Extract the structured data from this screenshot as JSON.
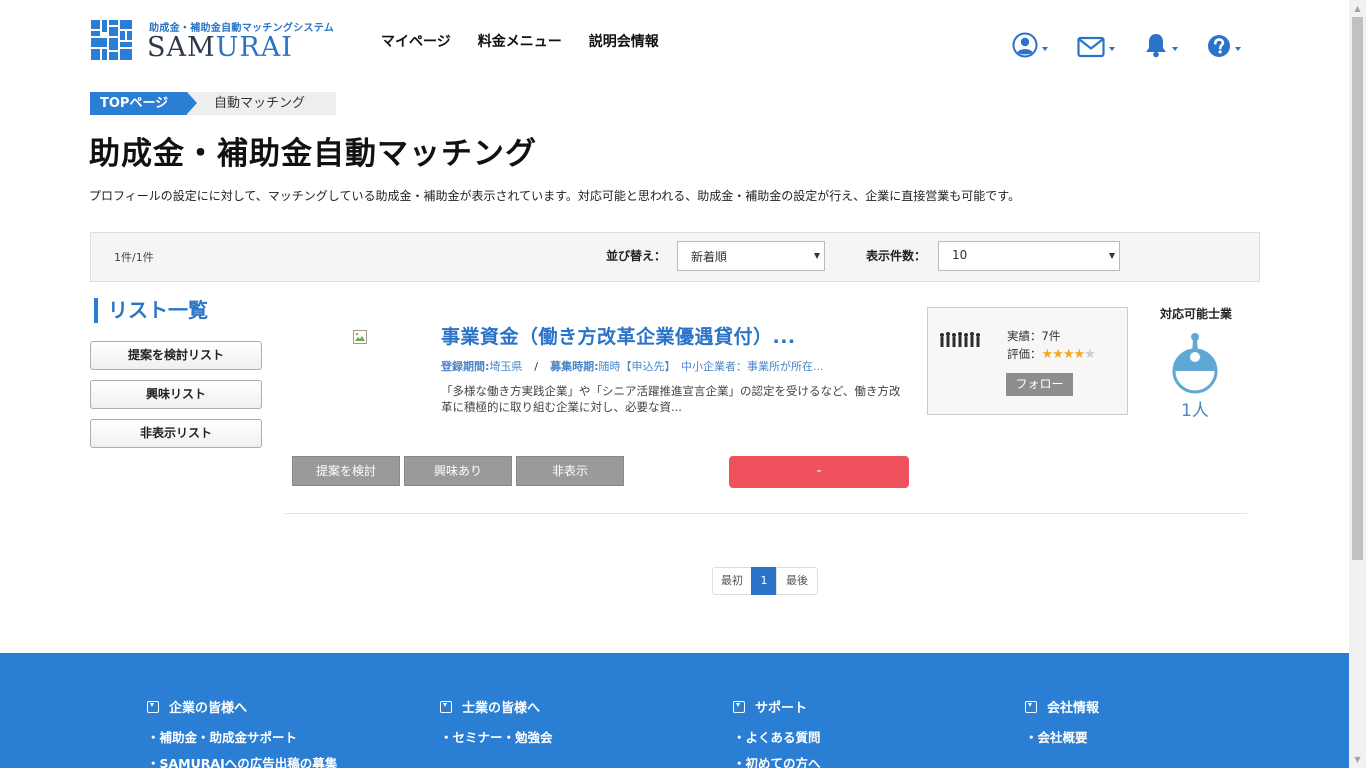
{
  "brand": {
    "subtitle": "助成金・補助金自動マッチングシステム",
    "name_dark": "SAM",
    "name_accent": "URAI",
    "accent_color": "#2a73c8"
  },
  "nav": {
    "items": [
      {
        "label": "マイページ"
      },
      {
        "label": "料金メニュー"
      },
      {
        "label": "説明会情報"
      }
    ]
  },
  "header_icons": [
    "user-icon",
    "mail-icon",
    "bell-icon",
    "help-icon"
  ],
  "breadcrumb": {
    "top": "TOPページ",
    "current": "自動マッチング"
  },
  "page": {
    "title": "助成金・補助金自動マッチング",
    "description": "プロフィールの設定にに対して、マッチングしている助成金・補助金が表示されています。対応可能と思われる、助成金・補助金の設定が行え、企業に直接営業も可能です。"
  },
  "filter": {
    "count": "1件/1件",
    "sort_label": "並び替え：",
    "sort_value": "新着順",
    "per_page_label": "表示件数：",
    "per_page_value": "10"
  },
  "sidebar": {
    "title": "リスト一覧",
    "buttons": [
      {
        "label": "提案を検討リスト"
      },
      {
        "label": "興味リスト"
      },
      {
        "label": "非表示リスト"
      }
    ]
  },
  "result": {
    "title": "事業資金（働き方改革企業優遇貸付）...",
    "meta_label_1": "登録期間:",
    "meta_value_1": "埼玉県",
    "meta_sep": "/",
    "meta_label_2": "募集時期:",
    "meta_value_2": "随時【申込先】　中小企業者：事業所が所在...",
    "description": "「多様な働き方実践企業」や「シニア活躍推進宣言企業」の認定を受けるなど、働き方改革に積極的に取り組む企業に対し、必要な資...",
    "profile": {
      "record": "実績：7件",
      "rating_label": "評価：",
      "rating": 4,
      "rating_max": 5,
      "follow": "フォロー"
    },
    "match_label": "対応可能士業",
    "match_count": "1人",
    "actions": [
      {
        "label": "提案を検討"
      },
      {
        "label": "興味あり"
      },
      {
        "label": "非表示"
      }
    ],
    "status_button": "-"
  },
  "pager": {
    "first": "最初",
    "current": "1",
    "last": "最後"
  },
  "footer": {
    "columns": [
      {
        "heading": "企業の皆様へ",
        "links": [
          "・補助金・助成金サポート",
          "・SAMURAIへの広告出稿の募集"
        ]
      },
      {
        "heading": "士業の皆様へ",
        "links": [
          "・セミナー・勉強会"
        ]
      },
      {
        "heading": "サポート",
        "links": [
          "・よくある質問",
          "・初めての方へ"
        ]
      },
      {
        "heading": "会社情報",
        "links": [
          "・会社概要"
        ]
      }
    ]
  }
}
